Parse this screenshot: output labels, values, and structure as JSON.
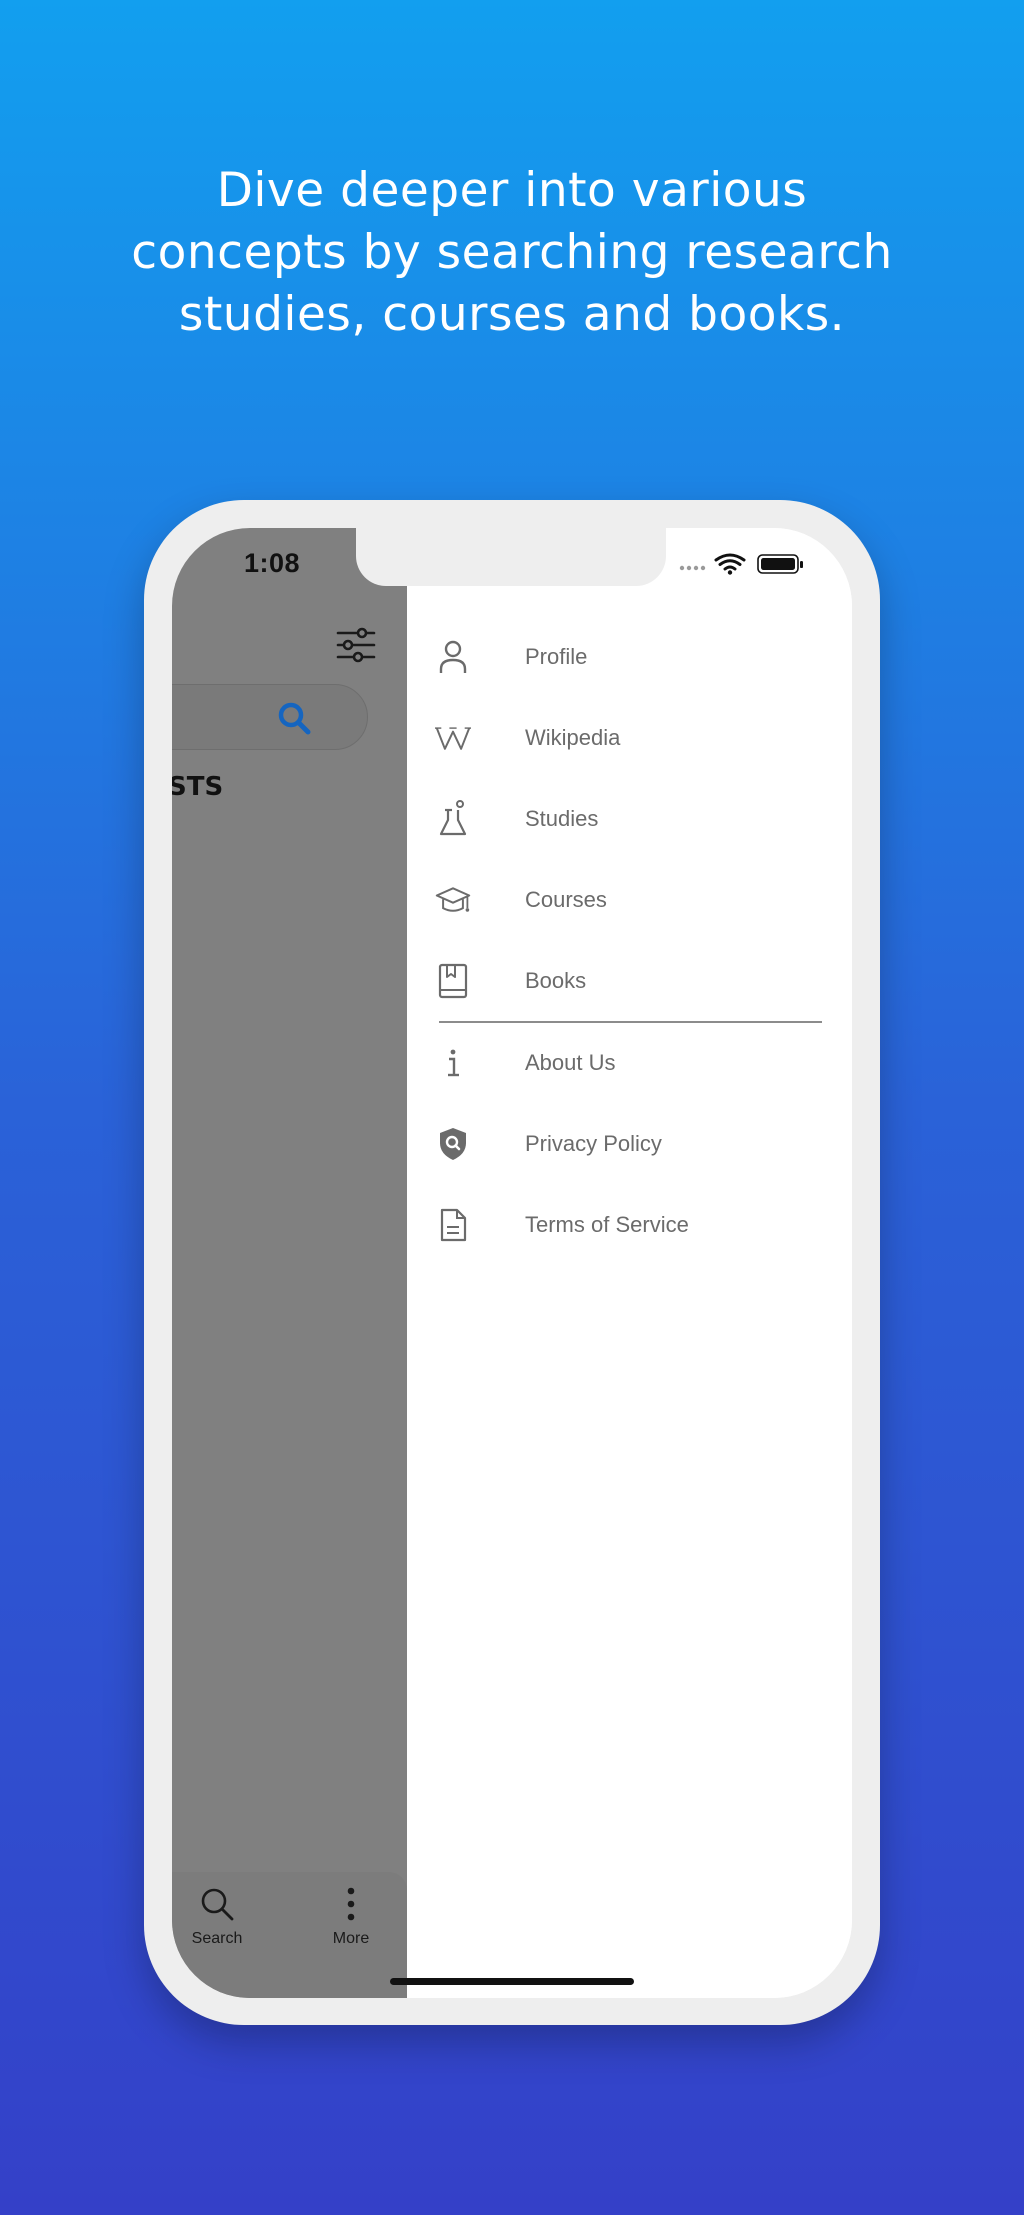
{
  "headline": {
    "line1": "Dive deeper into various",
    "line2": "concepts by searching research",
    "line3": "studies, courses and books."
  },
  "status_bar": {
    "time": "1:08",
    "icons": [
      "signal-dots-icon",
      "wifi-icon",
      "battery-icon"
    ]
  },
  "background_app": {
    "partial_section_label": "STS",
    "tabs": [
      {
        "label": "Search",
        "icon": "search-icon"
      },
      {
        "label": "More",
        "icon": "more-vertical-icon"
      }
    ]
  },
  "drawer": {
    "primary_items": [
      {
        "label": "Profile",
        "icon": "person-icon"
      },
      {
        "label": "Wikipedia",
        "icon": "wikipedia-icon"
      },
      {
        "label": "Studies",
        "icon": "flask-icon"
      },
      {
        "label": "Courses",
        "icon": "graduation-cap-icon"
      },
      {
        "label": "Books",
        "icon": "book-icon"
      }
    ],
    "secondary_items": [
      {
        "label": "About Us",
        "icon": "info-icon"
      },
      {
        "label": "Privacy Policy",
        "icon": "shield-search-icon"
      },
      {
        "label": "Terms of Service",
        "icon": "document-icon"
      }
    ]
  },
  "colors": {
    "gradient_top": "#129fef",
    "gradient_bottom": "#3440c8",
    "overlay_gray": "#808080",
    "search_accent": "#1565c0",
    "menu_text": "#6b6b6b"
  }
}
